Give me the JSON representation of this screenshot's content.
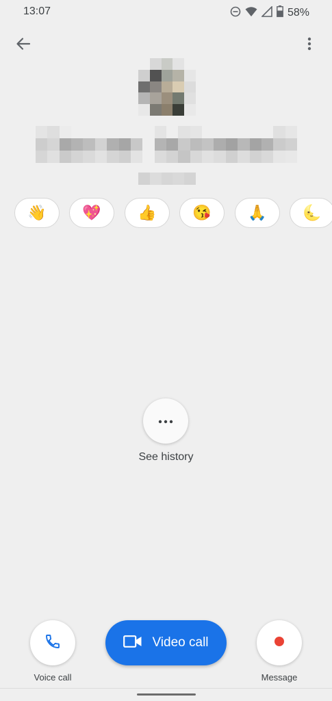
{
  "status_bar": {
    "time": "13:07",
    "battery_percent": "58%",
    "icons": [
      "do-not-disturb-icon",
      "wifi-icon",
      "cell-signal-icon",
      "battery-icon"
    ]
  },
  "header": {
    "back_icon": "arrow-back-icon",
    "menu_icon": "more-vert-icon"
  },
  "contact": {
    "avatar": "pixelated-avatar",
    "name_obscured": true
  },
  "emoji_reactions": [
    {
      "emoji": "👋",
      "name": "waving-hand"
    },
    {
      "emoji": "💖",
      "name": "sparkling-heart"
    },
    {
      "emoji": "👍",
      "name": "thumbs-up"
    },
    {
      "emoji": "😘",
      "name": "face-blowing-kiss"
    },
    {
      "emoji": "🙏",
      "name": "folded-hands"
    },
    {
      "emoji": "🌜",
      "name": "moon"
    }
  ],
  "history": {
    "label": "See history",
    "icon": "more-horiz-icon"
  },
  "actions": {
    "voice_call": {
      "label": "Voice call",
      "icon": "phone-icon"
    },
    "video_call": {
      "label": "Video call",
      "icon": "videocam-icon"
    },
    "message": {
      "label": "Message",
      "icon": "record-icon"
    }
  },
  "colors": {
    "primary": "#1a73e8",
    "record": "#ea4335",
    "background": "#efefef"
  }
}
